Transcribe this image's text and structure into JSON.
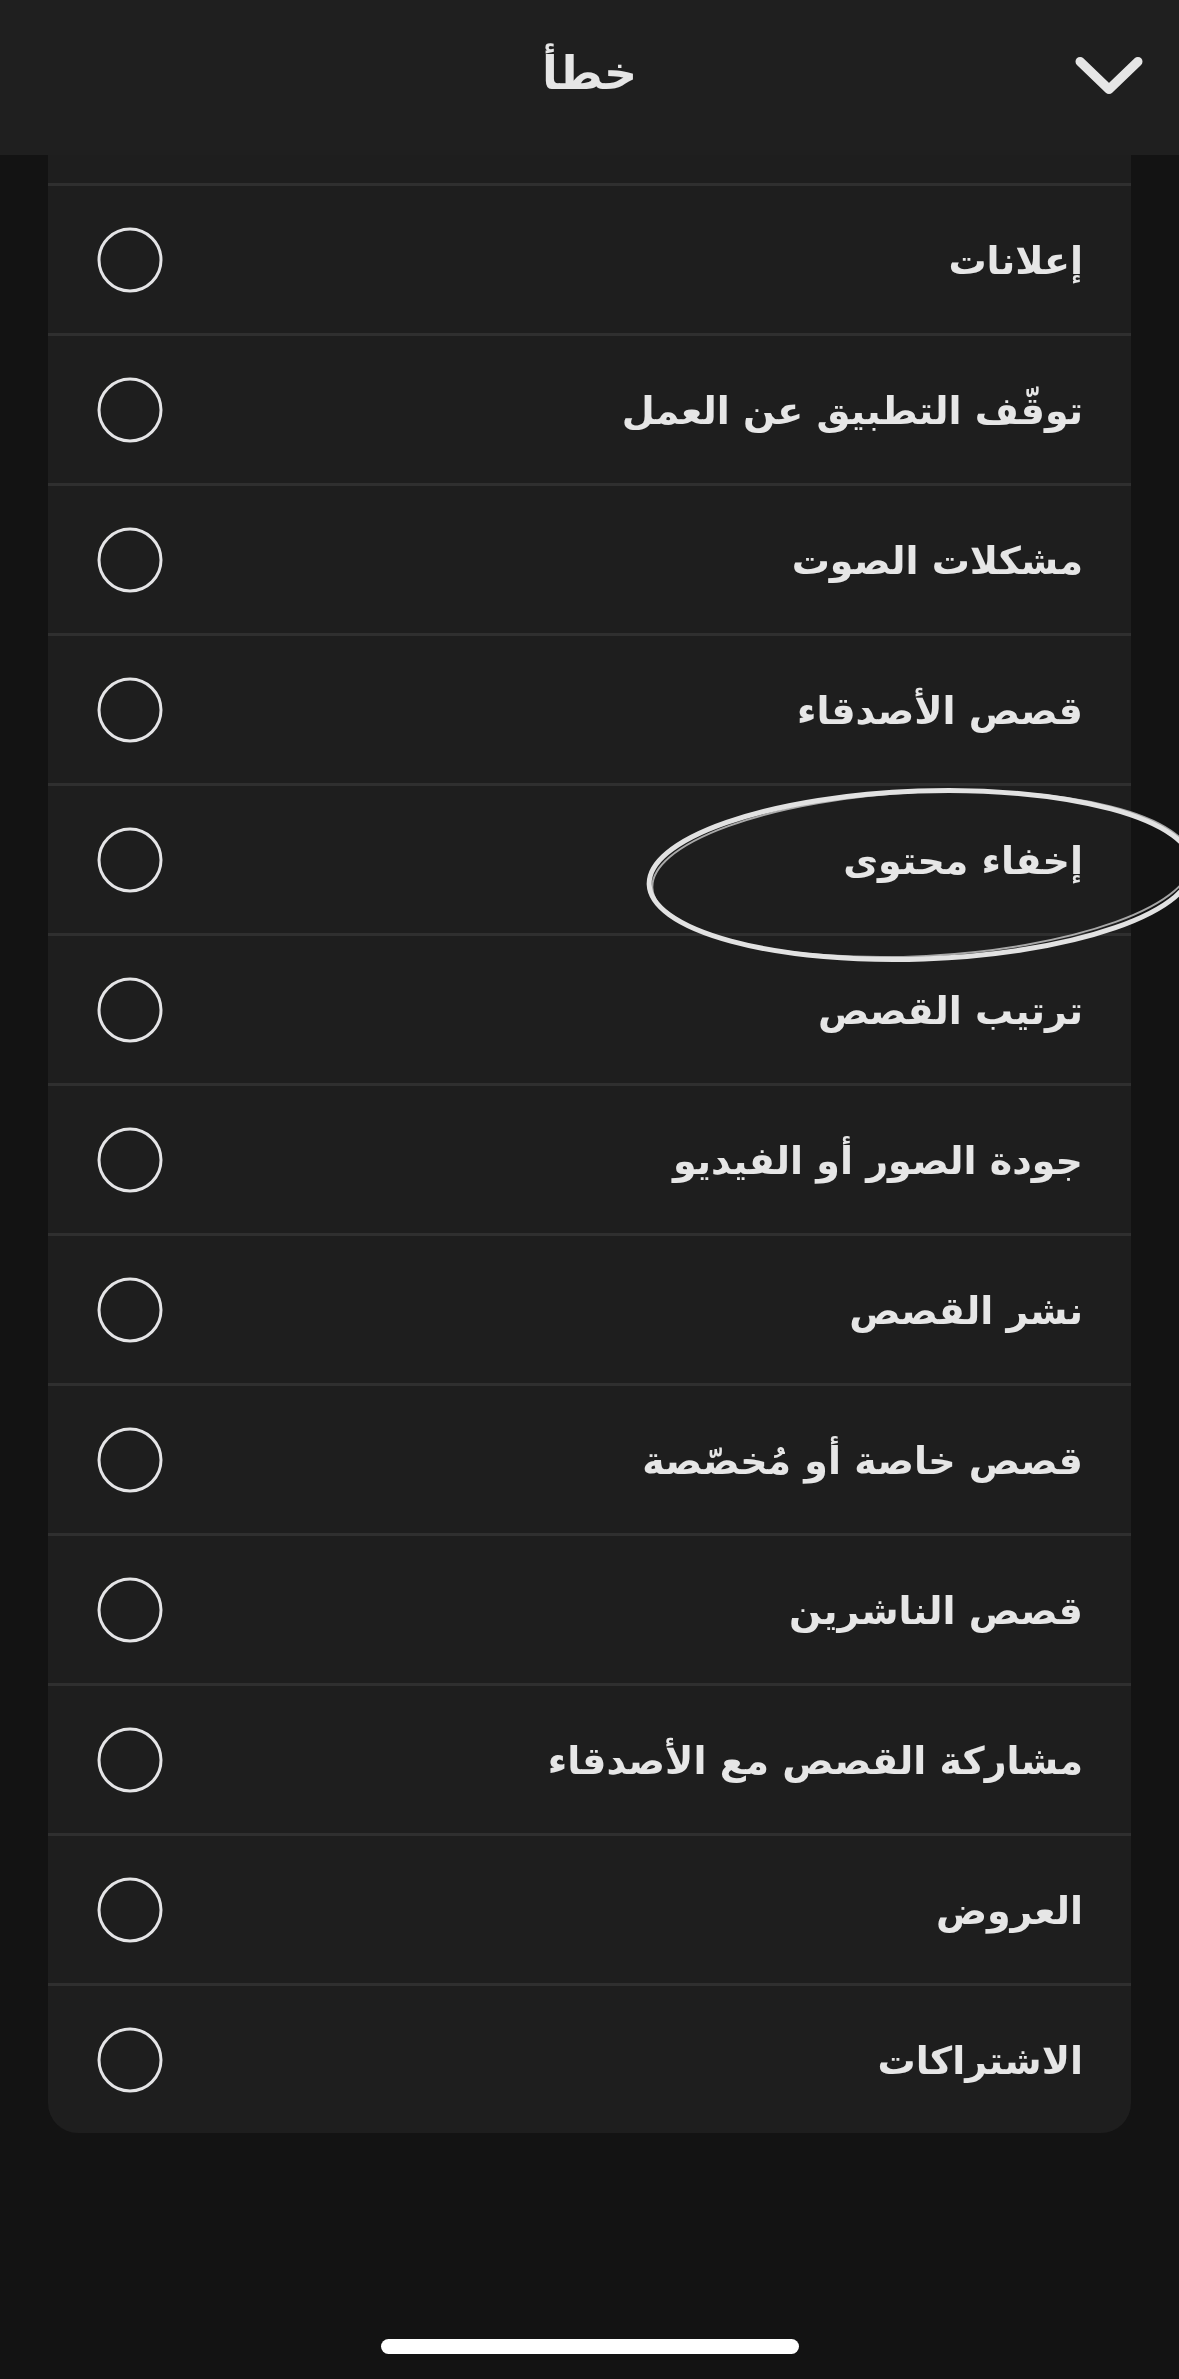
{
  "header": {
    "title": "خطأ"
  },
  "options": [
    {
      "label": "إعلانات",
      "selected": false,
      "circled": false
    },
    {
      "label": "توقّف التطبيق عن العمل",
      "selected": false,
      "circled": false
    },
    {
      "label": "مشكلات الصوت",
      "selected": false,
      "circled": false
    },
    {
      "label": "قصص الأصدقاء",
      "selected": false,
      "circled": false
    },
    {
      "label": "إخفاء محتوى",
      "selected": false,
      "circled": true
    },
    {
      "label": "ترتيب القصص",
      "selected": false,
      "circled": false
    },
    {
      "label": "جودة الصور أو الفيديو",
      "selected": false,
      "circled": false
    },
    {
      "label": "نشر القصص",
      "selected": false,
      "circled": false
    },
    {
      "label": "قصص خاصة أو مُخصّصة",
      "selected": false,
      "circled": false
    },
    {
      "label": "قصص الناشرين",
      "selected": false,
      "circled": false
    },
    {
      "label": "مشاركة القصص مع الأصدقاء",
      "selected": false,
      "circled": false
    },
    {
      "label": "العروض",
      "selected": false,
      "circled": false
    },
    {
      "label": "الاشتراكات",
      "selected": false,
      "circled": false
    }
  ]
}
